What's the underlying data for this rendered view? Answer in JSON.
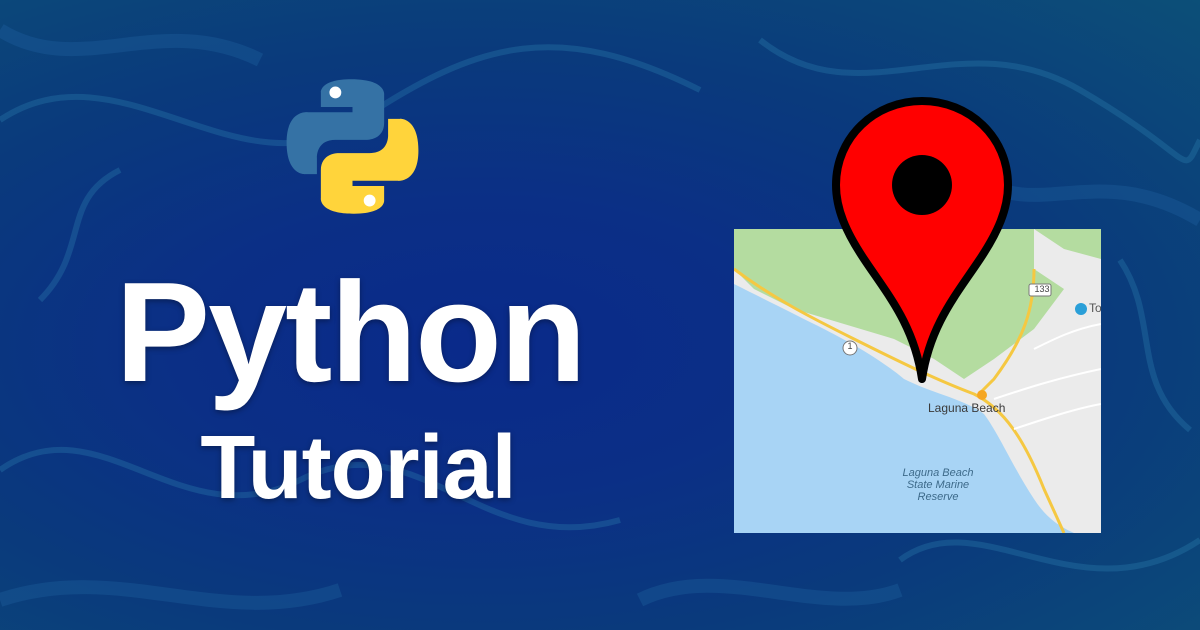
{
  "title": "Python",
  "subtitle": "Tutorial",
  "map": {
    "town_label": "Laguna Beach",
    "reserve_label": "Laguna Beach State Marine Reserve",
    "route_a": "133",
    "route_b": "1",
    "cut_label": "To"
  },
  "icons": {
    "logo": "python-logo-icon",
    "pin": "map-pin-icon"
  },
  "colors": {
    "background": "#0b2f86",
    "title": "#ffffff",
    "pin": "#ff0000",
    "python_blue": "#3572a5",
    "python_yellow": "#ffd43b",
    "water": "#a8d4f5",
    "park": "#b4dca0",
    "land": "#ebebeb"
  }
}
